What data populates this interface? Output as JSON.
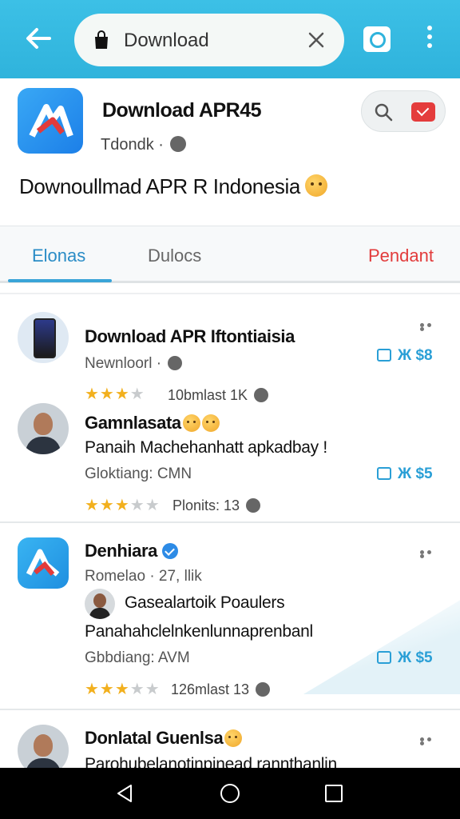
{
  "topbar": {
    "search_query": "Download",
    "icons": [
      "back-arrow-icon",
      "shopping-bag-icon",
      "clear-icon",
      "camera-icon",
      "more-vert-icon"
    ],
    "color": "#35b8e0"
  },
  "header": {
    "title": "Download APR45",
    "subtitle": "Tdondk ·",
    "headline": "Downoullmad APR R Indonesia"
  },
  "tabs": [
    {
      "label": "Elonas",
      "active": true
    },
    {
      "label": "Dulocs",
      "active": false
    },
    {
      "label": "Pendant",
      "active": false
    }
  ],
  "feed": [
    {
      "title": "Download APR Iftontiaisia",
      "meta": "Newnloorl ·",
      "rating": 3.5,
      "rating_meta": "10bmlast   1K",
      "price": "Ж $8"
    },
    {
      "title": "Gamnlasata",
      "line": "Panaih Machehanhatt apkadbay !",
      "meta": "Gloktiang: CMN",
      "rating": 3,
      "rating_meta": "Plonits:   13",
      "price": "Ж $5"
    },
    {
      "title": "Denhiara",
      "meta": "Romelao · 27, llik",
      "sub_title": "Gasealartoik Poaulers",
      "line": "Panahahclelnkenlunnaprenbanl",
      "meta2": "Gbbdiang: AVM",
      "rating": 3,
      "rating_meta": "126mlast   13",
      "price": "Ж $5"
    },
    {
      "title": "Donlatal Guenlsa",
      "line": "Parohubelanotinpinead rannthanlin"
    }
  ]
}
